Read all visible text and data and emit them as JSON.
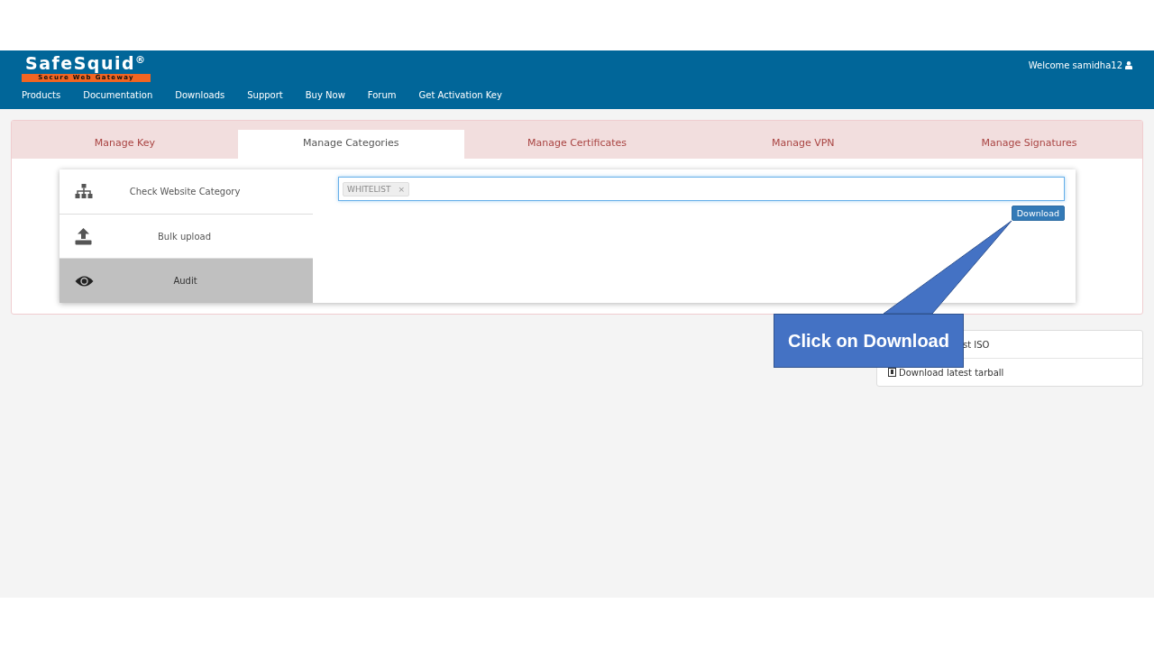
{
  "header": {
    "logo": {
      "name": "SafeSquid",
      "mark": "®",
      "tagline": "Secure Web Gateway"
    },
    "welcome": "Welcome samidha12",
    "nav": [
      "Products",
      "Documentation",
      "Downloads",
      "Support",
      "Buy Now",
      "Forum",
      "Get Activation Key"
    ]
  },
  "tabs": [
    {
      "label": "Manage Key",
      "selected": false
    },
    {
      "label": "Manage Categories",
      "selected": true
    },
    {
      "label": "Manage Certificates",
      "selected": false
    },
    {
      "label": "Manage VPN",
      "selected": false
    },
    {
      "label": "Manage Signatures",
      "selected": false
    }
  ],
  "side_menu": [
    {
      "label": "Check Website Category",
      "selected": false
    },
    {
      "label": "Bulk upload",
      "selected": false
    },
    {
      "label": "Audit",
      "selected": true
    }
  ],
  "tag_field": {
    "tags": [
      "WHITELIST"
    ],
    "remove": "×"
  },
  "download_button": "Download",
  "downloads": [
    {
      "label": "st ISO"
    },
    {
      "label": "Download latest tarball"
    }
  ],
  "callout": "Click on Download"
}
